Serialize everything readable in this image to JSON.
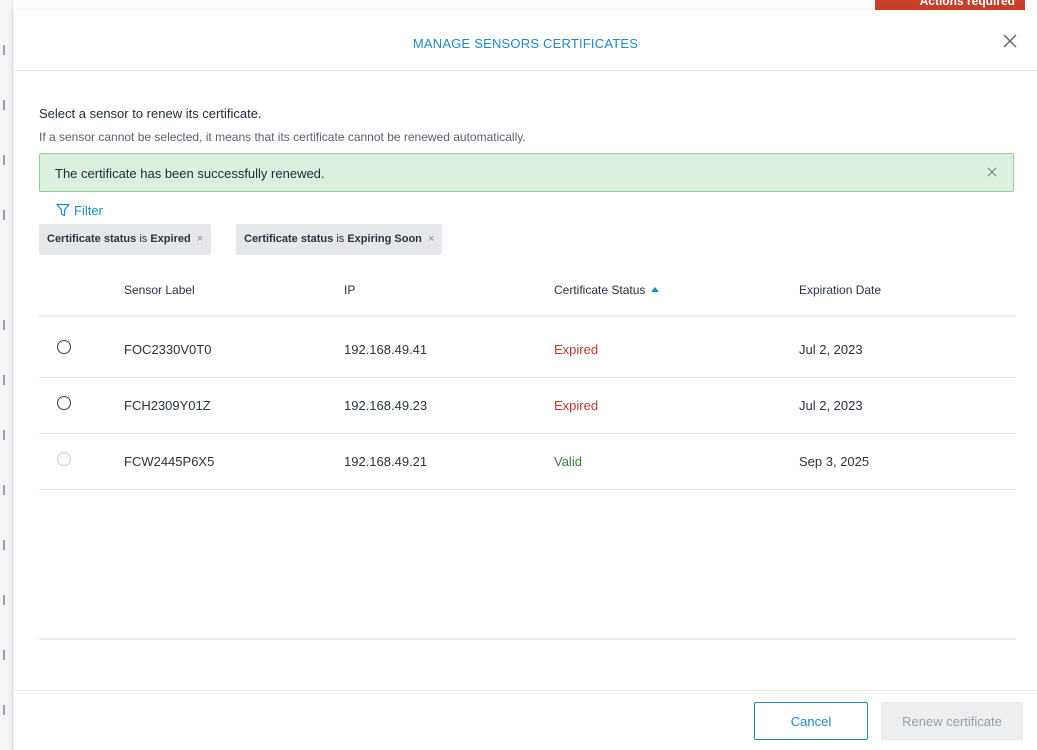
{
  "background": {
    "banner_text": "Actions required"
  },
  "modal": {
    "title": "MANAGE SENSORS CERTIFICATES",
    "intro_line1": "Select a sensor to renew its certificate.",
    "intro_line2": "If a sensor cannot be selected, it means that its certificate cannot be renewed automatically.",
    "alert": "The certificate has been successfully renewed.",
    "filter_label": "Filter",
    "chips": [
      {
        "field": "Certificate status",
        "op": "is",
        "value": "Expired"
      },
      {
        "field": "Certificate status",
        "op": "is",
        "value": "Expiring Soon"
      }
    ],
    "table": {
      "columns": [
        "Sensor Label",
        "IP",
        "Certificate Status",
        "Expiration Date"
      ],
      "sorted_column": "Certificate Status",
      "sort_direction": "ascending",
      "rows": [
        {
          "label": "FOC2330V0T0",
          "ip": "192.168.49.41",
          "status": "Expired",
          "expiration": "Jul 2, 2023",
          "selectable": true
        },
        {
          "label": "FCH2309Y01Z",
          "ip": "192.168.49.23",
          "status": "Expired",
          "expiration": "Jul 2, 2023",
          "selectable": true
        },
        {
          "label": "FCW2445P6X5",
          "ip": "192.168.49.21",
          "status": "Valid",
          "expiration": "Sep 3, 2025",
          "selectable": false
        }
      ]
    },
    "buttons": {
      "cancel": "Cancel",
      "renew": "Renew certificate"
    }
  },
  "colors": {
    "accent": "#1f8ac0",
    "expired": "#c0392b",
    "valid": "#3e7a3b",
    "alert_bg": "#dcf0e0",
    "alert_border": "#8fcf9c"
  },
  "icons": [
    "close-icon",
    "filter-icon",
    "sort-asc-icon",
    "radio-icon"
  ]
}
